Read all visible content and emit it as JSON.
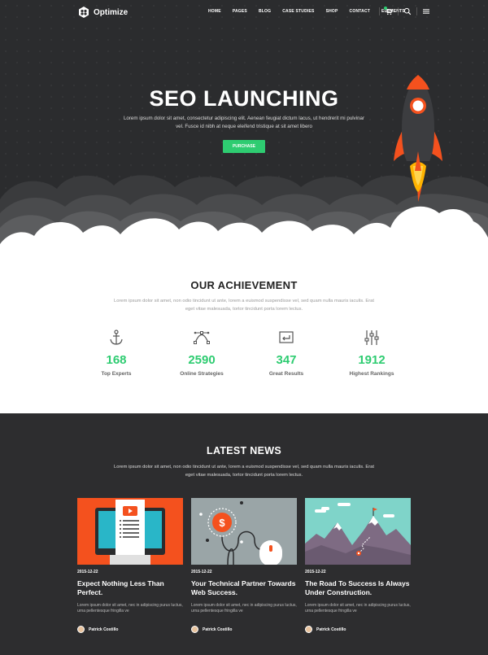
{
  "brand": {
    "name": "Optimize"
  },
  "nav": {
    "items": [
      "HOME",
      "PAGES",
      "BLOG",
      "CASE STUDIES",
      "SHOP",
      "CONTACT",
      "ELEMENTS"
    ],
    "icons": [
      "cart-icon",
      "search-icon",
      "menu-icon"
    ]
  },
  "hero": {
    "title": "SEO LAUNCHING",
    "text": "Lorem ipsum dolor sit amet, consectetur adipiscing elit. Aenean feugiat dictum lacus, ut hendrerit mi pulvinar vel. Fusce id nibh at neque eleifend tristique at sit amet libero",
    "button": "PURCHASE"
  },
  "achievement": {
    "title": "OUR ACHIEVEMENT",
    "text": "Lorem ipsum dolor sit amet, non odio tincidunt ut ante, lorem a euismod suspendisse vel, sed quam nulla mauris iaculis. Erat eget vitae malesuada, tortor tincidunt porta lorem lectus.",
    "stats": [
      {
        "icon": "anchor-icon",
        "value": "168",
        "label": "Top Experts"
      },
      {
        "icon": "bezier-icon",
        "value": "2590",
        "label": "Online Strategies"
      },
      {
        "icon": "return-arrow-icon",
        "value": "347",
        "label": "Great Results"
      },
      {
        "icon": "sliders-icon",
        "value": "1912",
        "label": "Highest Rankings"
      }
    ]
  },
  "news": {
    "title": "LATEST NEWS",
    "text": "Lorem ipsum dolor sit amet, non odio tincidunt ut ante, lorem a euismod suspendisse vel, sed quam nulla mauris iaculis. Erat eget vitae malesuada, tortor tincidunt porta lorem lectus.",
    "cards": [
      {
        "date": "2015-12-22",
        "title": "Expect Nothing Less Than Perfect.",
        "excerpt": "Lorem ipsum dolor sit amet, nec in adipiscing purus luctus, urna pellentesque fringilla ve",
        "author": "Patrick Costillo"
      },
      {
        "date": "2015-12-22",
        "title": "Your Technical Partner Towards Web Success.",
        "excerpt": "Lorem ipsum dolor sit amet, nec in adipiscing purus luctus, urna pellentesque fringilla ve",
        "author": "Patrick Costillo"
      },
      {
        "date": "2015-12-22",
        "title": "The Road To Success Is Always Under Construction.",
        "excerpt": "Lorem ipsum dolor sit amet, nec in adipiscing purus luctus, urna pellentesque fringilla ve",
        "author": "Patrick Costillo"
      }
    ]
  },
  "colors": {
    "accent": "#2ecc71",
    "hero_bg": "#2b2c2e",
    "news_bg": "#2d2d2f",
    "rocket": "#f4511e"
  }
}
